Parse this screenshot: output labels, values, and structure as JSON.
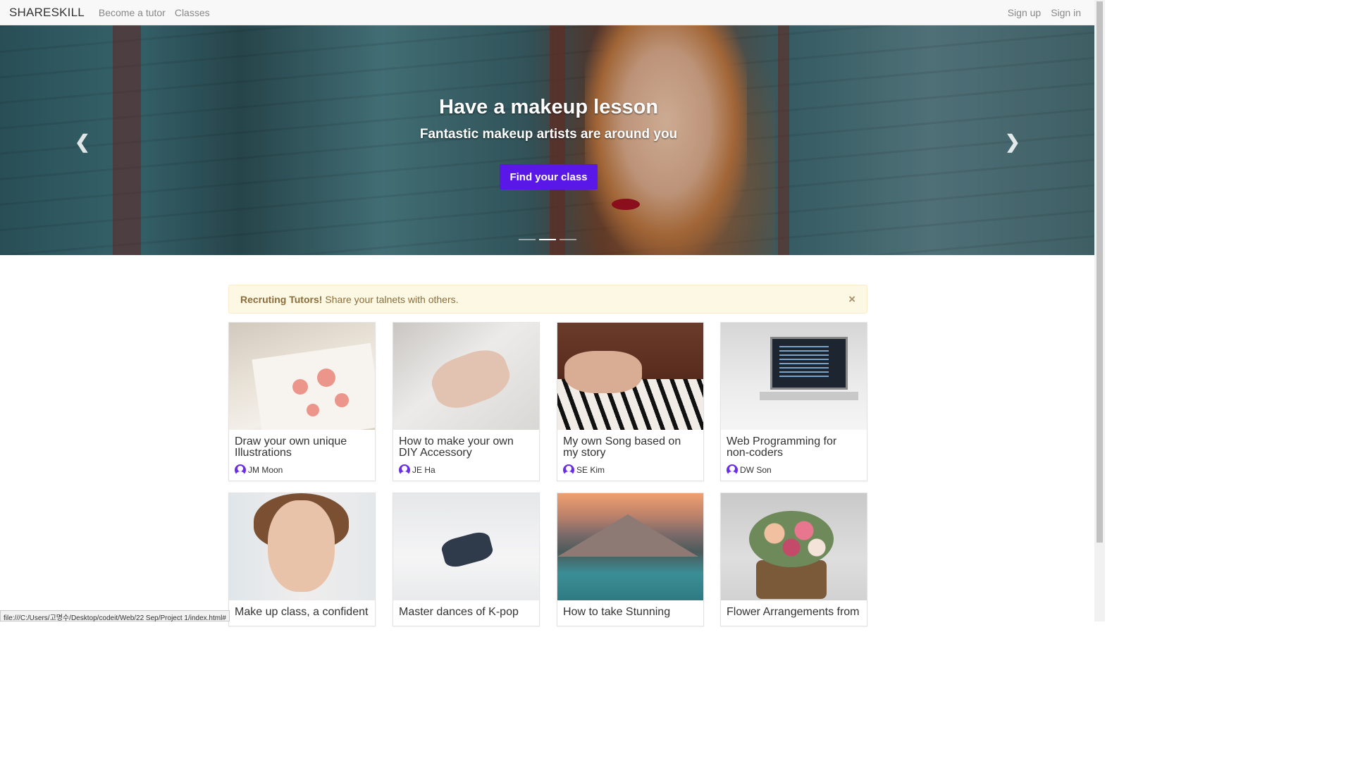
{
  "nav": {
    "brand": "SHARESKILL",
    "links": [
      "Become a tutor",
      "Classes"
    ],
    "right_links": [
      "Sign up",
      "Sign in"
    ]
  },
  "hero": {
    "title": "Have a makeup lesson",
    "subtitle": "Fantastic makeup artists are around you",
    "button_label": "Find your class",
    "prev_icon": "chevron-left-icon",
    "next_icon": "chevron-right-icon",
    "prev_glyph": "❮",
    "next_glyph": "❯",
    "slide_count": 3,
    "active_slide": 2
  },
  "alert": {
    "strong": "Recruting Tutors!",
    "text": "Share your talnets with others.",
    "close_glyph": "×"
  },
  "cards": [
    {
      "title": "Draw your own unique Illustrations",
      "author": "JM Moon"
    },
    {
      "title": "How to make your own DIY Accessory",
      "author": "JE Ha"
    },
    {
      "title": "My own Song based on my story",
      "author": "SE Kim"
    },
    {
      "title": "Web Programming for non-coders",
      "author": "DW Son"
    },
    {
      "title": "Make up class, a confident",
      "author": ""
    },
    {
      "title": "Master dances of K-pop",
      "author": ""
    },
    {
      "title": "How to take Stunning",
      "author": ""
    },
    {
      "title": "Flower Arrangements from",
      "author": ""
    }
  ],
  "statusbar": {
    "url": "file:///C:/Users/고명수/Desktop/codeit/Web/22 Sep/Project 1/index.html#"
  },
  "colors": {
    "accent": "#5a18e8",
    "alert_bg": "#fcf8e3",
    "alert_text": "#8a6d3b"
  }
}
